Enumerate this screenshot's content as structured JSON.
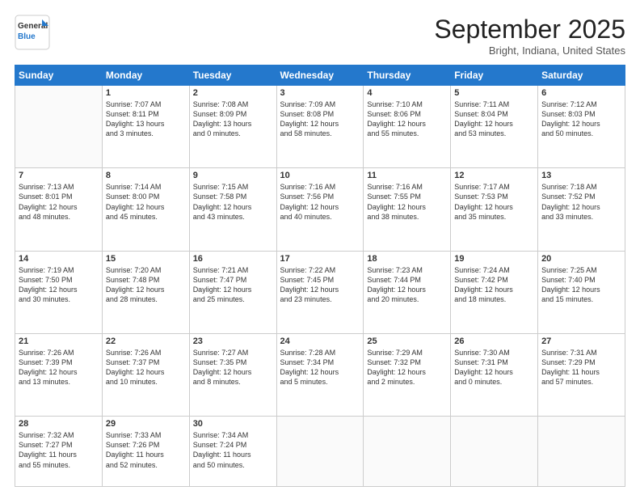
{
  "header": {
    "logo_general": "General",
    "logo_blue": "Blue",
    "month_title": "September 2025",
    "location": "Bright, Indiana, United States"
  },
  "days_of_week": [
    "Sunday",
    "Monday",
    "Tuesday",
    "Wednesday",
    "Thursday",
    "Friday",
    "Saturday"
  ],
  "weeks": [
    [
      {
        "day": "",
        "content": ""
      },
      {
        "day": "1",
        "content": "Sunrise: 7:07 AM\nSunset: 8:11 PM\nDaylight: 13 hours\nand 3 minutes."
      },
      {
        "day": "2",
        "content": "Sunrise: 7:08 AM\nSunset: 8:09 PM\nDaylight: 13 hours\nand 0 minutes."
      },
      {
        "day": "3",
        "content": "Sunrise: 7:09 AM\nSunset: 8:08 PM\nDaylight: 12 hours\nand 58 minutes."
      },
      {
        "day": "4",
        "content": "Sunrise: 7:10 AM\nSunset: 8:06 PM\nDaylight: 12 hours\nand 55 minutes."
      },
      {
        "day": "5",
        "content": "Sunrise: 7:11 AM\nSunset: 8:04 PM\nDaylight: 12 hours\nand 53 minutes."
      },
      {
        "day": "6",
        "content": "Sunrise: 7:12 AM\nSunset: 8:03 PM\nDaylight: 12 hours\nand 50 minutes."
      }
    ],
    [
      {
        "day": "7",
        "content": "Sunrise: 7:13 AM\nSunset: 8:01 PM\nDaylight: 12 hours\nand 48 minutes."
      },
      {
        "day": "8",
        "content": "Sunrise: 7:14 AM\nSunset: 8:00 PM\nDaylight: 12 hours\nand 45 minutes."
      },
      {
        "day": "9",
        "content": "Sunrise: 7:15 AM\nSunset: 7:58 PM\nDaylight: 12 hours\nand 43 minutes."
      },
      {
        "day": "10",
        "content": "Sunrise: 7:16 AM\nSunset: 7:56 PM\nDaylight: 12 hours\nand 40 minutes."
      },
      {
        "day": "11",
        "content": "Sunrise: 7:16 AM\nSunset: 7:55 PM\nDaylight: 12 hours\nand 38 minutes."
      },
      {
        "day": "12",
        "content": "Sunrise: 7:17 AM\nSunset: 7:53 PM\nDaylight: 12 hours\nand 35 minutes."
      },
      {
        "day": "13",
        "content": "Sunrise: 7:18 AM\nSunset: 7:52 PM\nDaylight: 12 hours\nand 33 minutes."
      }
    ],
    [
      {
        "day": "14",
        "content": "Sunrise: 7:19 AM\nSunset: 7:50 PM\nDaylight: 12 hours\nand 30 minutes."
      },
      {
        "day": "15",
        "content": "Sunrise: 7:20 AM\nSunset: 7:48 PM\nDaylight: 12 hours\nand 28 minutes."
      },
      {
        "day": "16",
        "content": "Sunrise: 7:21 AM\nSunset: 7:47 PM\nDaylight: 12 hours\nand 25 minutes."
      },
      {
        "day": "17",
        "content": "Sunrise: 7:22 AM\nSunset: 7:45 PM\nDaylight: 12 hours\nand 23 minutes."
      },
      {
        "day": "18",
        "content": "Sunrise: 7:23 AM\nSunset: 7:44 PM\nDaylight: 12 hours\nand 20 minutes."
      },
      {
        "day": "19",
        "content": "Sunrise: 7:24 AM\nSunset: 7:42 PM\nDaylight: 12 hours\nand 18 minutes."
      },
      {
        "day": "20",
        "content": "Sunrise: 7:25 AM\nSunset: 7:40 PM\nDaylight: 12 hours\nand 15 minutes."
      }
    ],
    [
      {
        "day": "21",
        "content": "Sunrise: 7:26 AM\nSunset: 7:39 PM\nDaylight: 12 hours\nand 13 minutes."
      },
      {
        "day": "22",
        "content": "Sunrise: 7:26 AM\nSunset: 7:37 PM\nDaylight: 12 hours\nand 10 minutes."
      },
      {
        "day": "23",
        "content": "Sunrise: 7:27 AM\nSunset: 7:35 PM\nDaylight: 12 hours\nand 8 minutes."
      },
      {
        "day": "24",
        "content": "Sunrise: 7:28 AM\nSunset: 7:34 PM\nDaylight: 12 hours\nand 5 minutes."
      },
      {
        "day": "25",
        "content": "Sunrise: 7:29 AM\nSunset: 7:32 PM\nDaylight: 12 hours\nand 2 minutes."
      },
      {
        "day": "26",
        "content": "Sunrise: 7:30 AM\nSunset: 7:31 PM\nDaylight: 12 hours\nand 0 minutes."
      },
      {
        "day": "27",
        "content": "Sunrise: 7:31 AM\nSunset: 7:29 PM\nDaylight: 11 hours\nand 57 minutes."
      }
    ],
    [
      {
        "day": "28",
        "content": "Sunrise: 7:32 AM\nSunset: 7:27 PM\nDaylight: 11 hours\nand 55 minutes."
      },
      {
        "day": "29",
        "content": "Sunrise: 7:33 AM\nSunset: 7:26 PM\nDaylight: 11 hours\nand 52 minutes."
      },
      {
        "day": "30",
        "content": "Sunrise: 7:34 AM\nSunset: 7:24 PM\nDaylight: 11 hours\nand 50 minutes."
      },
      {
        "day": "",
        "content": ""
      },
      {
        "day": "",
        "content": ""
      },
      {
        "day": "",
        "content": ""
      },
      {
        "day": "",
        "content": ""
      }
    ]
  ]
}
